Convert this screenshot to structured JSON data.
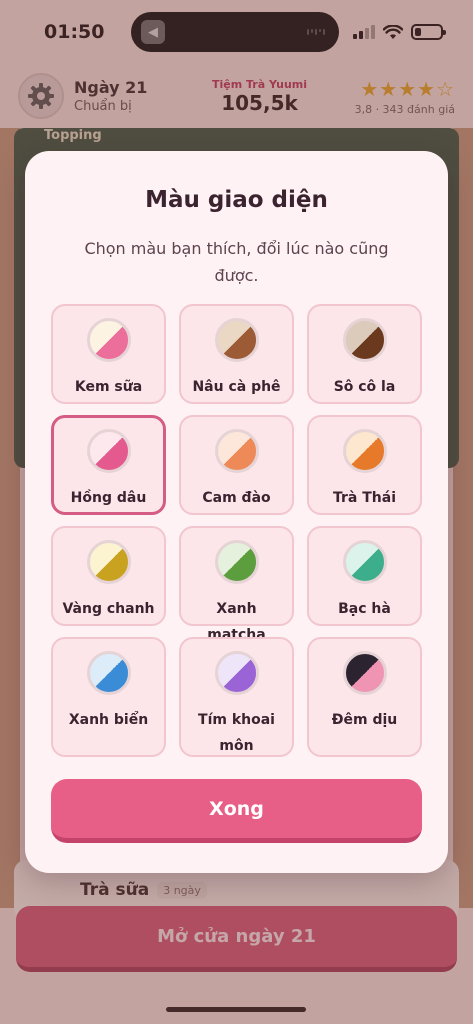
{
  "status_bar": {
    "time": "01:50"
  },
  "header": {
    "day": "Ngày 21",
    "phase": "Chuẩn bị",
    "shop_name": "Tiệm Trà Yuumi",
    "money": "105,5k",
    "stars": "★★★★☆",
    "rating": "3,8 · 343 đánh giá"
  },
  "background": {
    "board_label": "Topping",
    "lower_item": "Trà sữa",
    "lower_badge": "3 ngày",
    "open_button": "Mở cửa ngày 21"
  },
  "modal": {
    "title": "Màu giao diện",
    "subtitle": "Chọn màu bạn thích, đổi lúc nào cũng được.",
    "themes": [
      {
        "label": "Kem sữa",
        "color_a": "#fdf3e2",
        "color_b": "#ec6e9a",
        "selected": false
      },
      {
        "label": "Nâu cà phê",
        "color_a": "#ead8c4",
        "color_b": "#9c5a35",
        "selected": false
      },
      {
        "label": "Sô cô la",
        "color_a": "#dccabb",
        "color_b": "#6b3a1e",
        "selected": false
      },
      {
        "label": "Hồng dâu",
        "color_a": "#fde8ee",
        "color_b": "#e45a8e",
        "selected": true
      },
      {
        "label": "Cam đào",
        "color_a": "#fde7da",
        "color_b": "#ee8a58",
        "selected": false
      },
      {
        "label": "Trà Thái",
        "color_a": "#fde7cf",
        "color_b": "#e67a2a",
        "selected": false
      },
      {
        "label": "Vàng chanh",
        "color_a": "#fcf3d0",
        "color_b": "#c9a320",
        "selected": false
      },
      {
        "label": "Xanh matcha",
        "color_a": "#e5f1dc",
        "color_b": "#5c9e3e",
        "selected": false
      },
      {
        "label": "Bạc hà",
        "color_a": "#dcf3ec",
        "color_b": "#3cae8c",
        "selected": false
      },
      {
        "label": "Xanh biển",
        "color_a": "#dcecf9",
        "color_b": "#3a8cd6",
        "selected": false
      },
      {
        "label": "Tím khoai môn",
        "color_a": "#eee6f8",
        "color_b": "#9a64d6",
        "selected": false
      },
      {
        "label": "Đêm dịu",
        "color_a": "#2b2430",
        "color_b": "#ef95b3",
        "selected": false
      }
    ],
    "done_button": "Xong"
  }
}
